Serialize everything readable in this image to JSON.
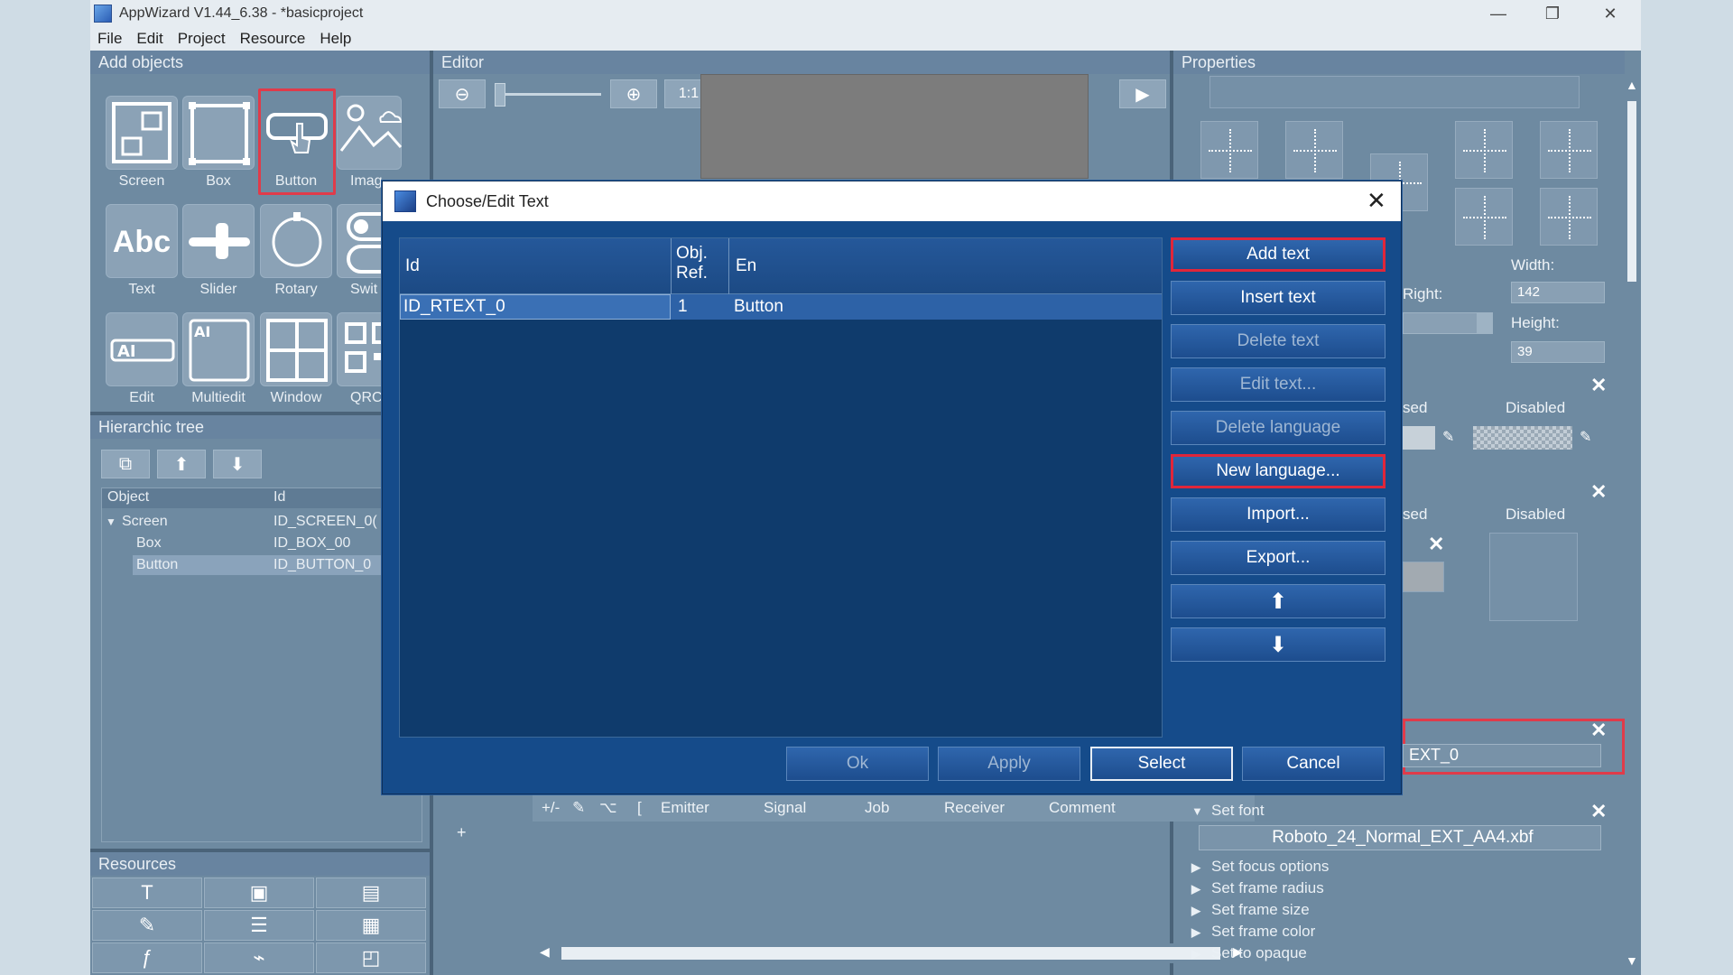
{
  "app": {
    "title": "AppWizard V1.44_6.38 - *basicproject",
    "minimize": "—",
    "restore": "❐",
    "close": "✕"
  },
  "menu": [
    "File",
    "Edit",
    "Project",
    "Resource",
    "Help"
  ],
  "panels": {
    "add_objects": "Add objects",
    "editor": "Editor",
    "properties": "Properties",
    "hier_tree": "Hierarchic tree",
    "resources": "Resources"
  },
  "objects": [
    {
      "label": "Screen",
      "icon": "screen-icon"
    },
    {
      "label": "Box",
      "icon": "box-icon"
    },
    {
      "label": "Button",
      "icon": "button-icon"
    },
    {
      "label": "Imag",
      "icon": "image-icon"
    },
    {
      "label": "Text",
      "icon": "text-icon"
    },
    {
      "label": "Slider",
      "icon": "slider-icon"
    },
    {
      "label": "Rotary",
      "icon": "rotary-icon"
    },
    {
      "label": "Swit",
      "icon": "switch-icon"
    },
    {
      "label": "Edit",
      "icon": "edit-icon"
    },
    {
      "label": "Multiedit",
      "icon": "multiedit-icon"
    },
    {
      "label": "Window",
      "icon": "window-icon"
    },
    {
      "label": "QRCo",
      "icon": "qrcode-icon"
    }
  ],
  "text_icon": "Abc",
  "edit_icon": "AI",
  "multiedit_icon": "AI",
  "tree": {
    "col_object": "Object",
    "col_id": "Id",
    "rows": [
      {
        "object": "Screen",
        "id": "ID_SCREEN_0("
      },
      {
        "object": "Box",
        "id": "ID_BOX_00"
      },
      {
        "object": "Button",
        "id": "ID_BUTTON_0"
      }
    ]
  },
  "editor": {
    "zoom_reset": "1:1"
  },
  "properties": {
    "width_label": "Width:",
    "width_value": "142",
    "right_label": "Right:",
    "height_label": "Height:",
    "height_value": "39",
    "sed1": "sed",
    "disabled1": "Disabled",
    "sed2": "sed",
    "disabled2": "Disabled",
    "text_id": "EXT_0",
    "set_font": "Set font",
    "font_value": "Roboto_24_Normal_EXT_AA4.xbf",
    "collapsed": [
      "Set focus options",
      "Set frame radius",
      "Set frame size",
      "Set frame color",
      "Set to opaque"
    ]
  },
  "signals": {
    "plusminus": "+/-",
    "bracket": "[",
    "emitter": "Emitter",
    "signal": "Signal",
    "job": "Job",
    "receiver": "Receiver",
    "comment": "Comment",
    "add": "+"
  },
  "dialog": {
    "title": "Choose/Edit Text",
    "close": "✕",
    "columns": {
      "id": "Id",
      "objref": "Obj.\nRef.",
      "en": "En"
    },
    "rows": [
      {
        "id": "ID_RTEXT_0",
        "ref": "1",
        "en": "Button"
      }
    ],
    "actions": [
      {
        "label": "Add text",
        "state": "highlight"
      },
      {
        "label": "Insert text",
        "state": "enabled"
      },
      {
        "label": "Delete text",
        "state": "disabled"
      },
      {
        "label": "Edit text...",
        "state": "disabled"
      },
      {
        "label": "Delete language",
        "state": "disabled"
      },
      {
        "label": "New language...",
        "state": "highlight"
      },
      {
        "label": "Import...",
        "state": "enabled"
      },
      {
        "label": "Export...",
        "state": "enabled"
      },
      {
        "label": "⬆",
        "state": "enabled"
      },
      {
        "label": "⬇",
        "state": "enabled"
      }
    ],
    "footer": {
      "ok": "Ok",
      "apply": "Apply",
      "select": "Select",
      "cancel": "Cancel"
    }
  }
}
